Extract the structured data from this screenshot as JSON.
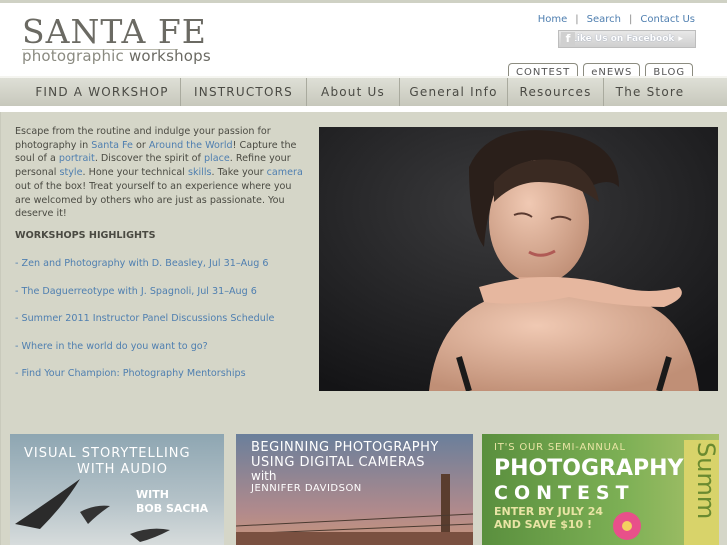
{
  "header": {
    "logo_main": "SANTA FE",
    "logo_sub_light": "photographic",
    "logo_sub_bold": "workshops",
    "top_links": [
      "Home",
      "Search",
      "Contact Us"
    ],
    "link_separator": "|",
    "facebook_label": "Like Us on Facebook",
    "tabs": [
      "CONTEST",
      "eNEWS",
      "BLOG"
    ]
  },
  "nav": {
    "items": [
      "FIND A WORKSHOP",
      "INSTRUCTORS",
      "About Us",
      "General Info",
      "Resources",
      "The Store"
    ]
  },
  "intro": {
    "t1": "Escape from the routine and indulge your passion for photography in ",
    "l1": "Santa Fe",
    "t2": " or ",
    "l2": "Around the World",
    "t3": "! Capture the soul of a ",
    "l3": "portrait",
    "t4": ". Discover the spirit of ",
    "l4": "place",
    "t5": ". Refine your personal ",
    "l5": "style",
    "t6": ". Hone your technical ",
    "l6": "skills",
    "t7": ". Take your ",
    "l7": "camera",
    "t8": " out of the box! Treat yourself to an experience where you are welcomed by others who are just as passionate. You deserve it!"
  },
  "highlights": {
    "title": "WORKSHOPS HIGHLIGHTS",
    "items": [
      "- Zen and Photography with D. Beasley, Jul 31–Aug 6",
      "- The Daguerreotype with J. Spagnoli, Jul 31–Aug 6",
      "- Summer 2011 Instructor Panel Discussions Schedule",
      "- Where in the world do you want to go?",
      "- Find Your Champion: Photography Mentorships"
    ]
  },
  "promos": {
    "p1": {
      "line1": "VISUAL STORYTELLING",
      "line2": "WITH AUDIO",
      "line3": "WITH",
      "line4": "BOB SACHA"
    },
    "p2": {
      "line1": "BEGINNING PHOTOGRAPHY",
      "line2": "USING DIGITAL CAMERAS",
      "line3": "with",
      "line4": "JENNIFER DAVIDSON"
    },
    "p3": {
      "line1": "IT'S OUR SEMI-ANNUAL",
      "line2": "PHOTOGRAPHY",
      "line3": "CONTEST",
      "line4": "ENTER BY JULY 24",
      "line5": "AND SAVE $10 !",
      "side": "Summ"
    }
  },
  "colors": {
    "link": "#4f7fb0",
    "nav_bg": "#d3d4c7",
    "main_bg": "#d5d6c8"
  }
}
